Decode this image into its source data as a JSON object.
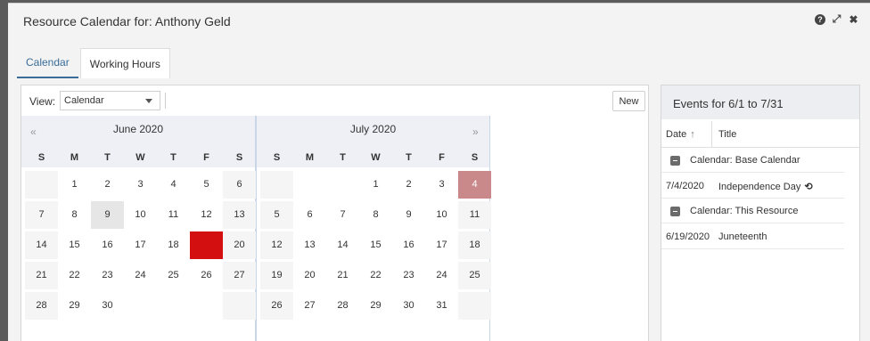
{
  "window": {
    "title": "Resource Calendar for: Anthony Geld",
    "icons": [
      "help-icon",
      "expand-icon",
      "close-icon"
    ]
  },
  "tabs": [
    {
      "label": "Calendar",
      "active": true
    },
    {
      "label": "Working Hours",
      "active": false
    }
  ],
  "toolbar": {
    "view_label": "View:",
    "view_value": "Calendar",
    "new_label": "New"
  },
  "calendar": {
    "weekday_headers": [
      "S",
      "M",
      "T",
      "W",
      "T",
      "F",
      "S"
    ],
    "months": [
      {
        "title": "June 2020",
        "prev_arrow": "«",
        "next_arrow": "",
        "weeks": [
          [
            "",
            "1",
            "2",
            "3",
            "4",
            "5",
            "6"
          ],
          [
            "7",
            "8",
            "9",
            "10",
            "11",
            "12",
            "13"
          ],
          [
            "14",
            "15",
            "16",
            "17",
            "18",
            "19",
            "20"
          ],
          [
            "21",
            "22",
            "23",
            "24",
            "25",
            "26",
            "27"
          ],
          [
            "28",
            "29",
            "30",
            "",
            "",
            "",
            ""
          ]
        ],
        "today": "9",
        "selected": "19",
        "holiday": ""
      },
      {
        "title": "July 2020",
        "prev_arrow": "",
        "next_arrow": "»",
        "weeks": [
          [
            "",
            "",
            "",
            "1",
            "2",
            "3",
            "4"
          ],
          [
            "5",
            "6",
            "7",
            "8",
            "9",
            "10",
            "11"
          ],
          [
            "12",
            "13",
            "14",
            "15",
            "16",
            "17",
            "18"
          ],
          [
            "19",
            "20",
            "21",
            "22",
            "23",
            "24",
            "25"
          ],
          [
            "26",
            "27",
            "28",
            "29",
            "30",
            "31",
            ""
          ]
        ],
        "today": "",
        "selected": "",
        "holiday": "4"
      }
    ],
    "colors": {
      "selected": "#d40f0f",
      "holiday": "#c9888a",
      "today": "#e6e6e6"
    }
  },
  "events": {
    "title": "Events for 6/1 to 7/31",
    "col_date": "Date",
    "col_title": "Title",
    "sort_icon": "↑",
    "groups": [
      {
        "label": "Calendar: Base Calendar",
        "rows": [
          {
            "date": "7/4/2020",
            "title": "Independence Day",
            "recurring": true
          }
        ]
      },
      {
        "label": "Calendar: This Resource",
        "rows": [
          {
            "date": "6/19/2020",
            "title": "Juneteenth",
            "recurring": false
          }
        ]
      }
    ]
  }
}
